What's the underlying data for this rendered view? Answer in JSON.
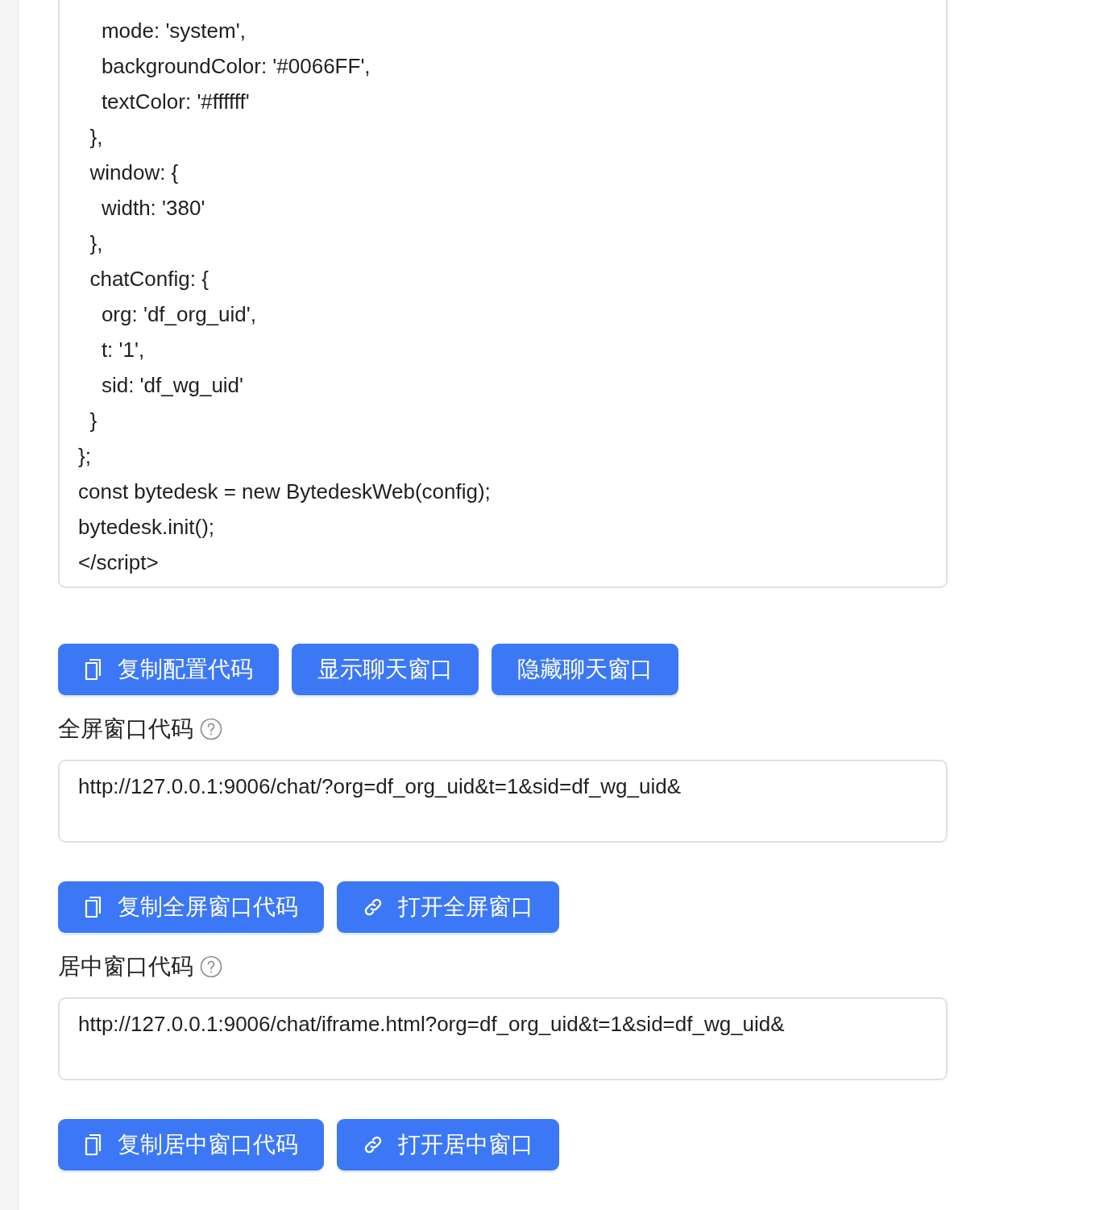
{
  "code_lines": [
    "    mode: 'system',",
    "    backgroundColor: '#0066FF',",
    "    textColor: '#ffffff'",
    "  },",
    "  window: {",
    "    width: '380'",
    "  },",
    "  chatConfig: {",
    "    org: 'df_org_uid',",
    "    t: '1',",
    "    sid: 'df_wg_uid'",
    "  }",
    "};",
    "const bytedesk = new BytedeskWeb(config);",
    "bytedesk.init();",
    "</script>"
  ],
  "code_actions": [
    {
      "label": "复制配置代码",
      "kind": "copy"
    },
    {
      "label": "显示聊天窗口",
      "kind": "plain"
    },
    {
      "label": "隐藏聊天窗口",
      "kind": "plain"
    }
  ],
  "sections": [
    {
      "title": "全屏窗口代码",
      "url": "http://127.0.0.1:9006/chat/?org=df_org_uid&t=1&sid=df_wg_uid&",
      "actions": [
        {
          "label": "复制全屏窗口代码",
          "kind": "copy"
        },
        {
          "label": "打开全屏窗口",
          "kind": "link"
        }
      ]
    },
    {
      "title": "居中窗口代码",
      "url": "http://127.0.0.1:9006/chat/iframe.html?org=df_org_uid&t=1&sid=df_wg_uid&",
      "actions": [
        {
          "label": "复制居中窗口代码",
          "kind": "copy"
        },
        {
          "label": "打开居中窗口",
          "kind": "link"
        }
      ]
    }
  ]
}
